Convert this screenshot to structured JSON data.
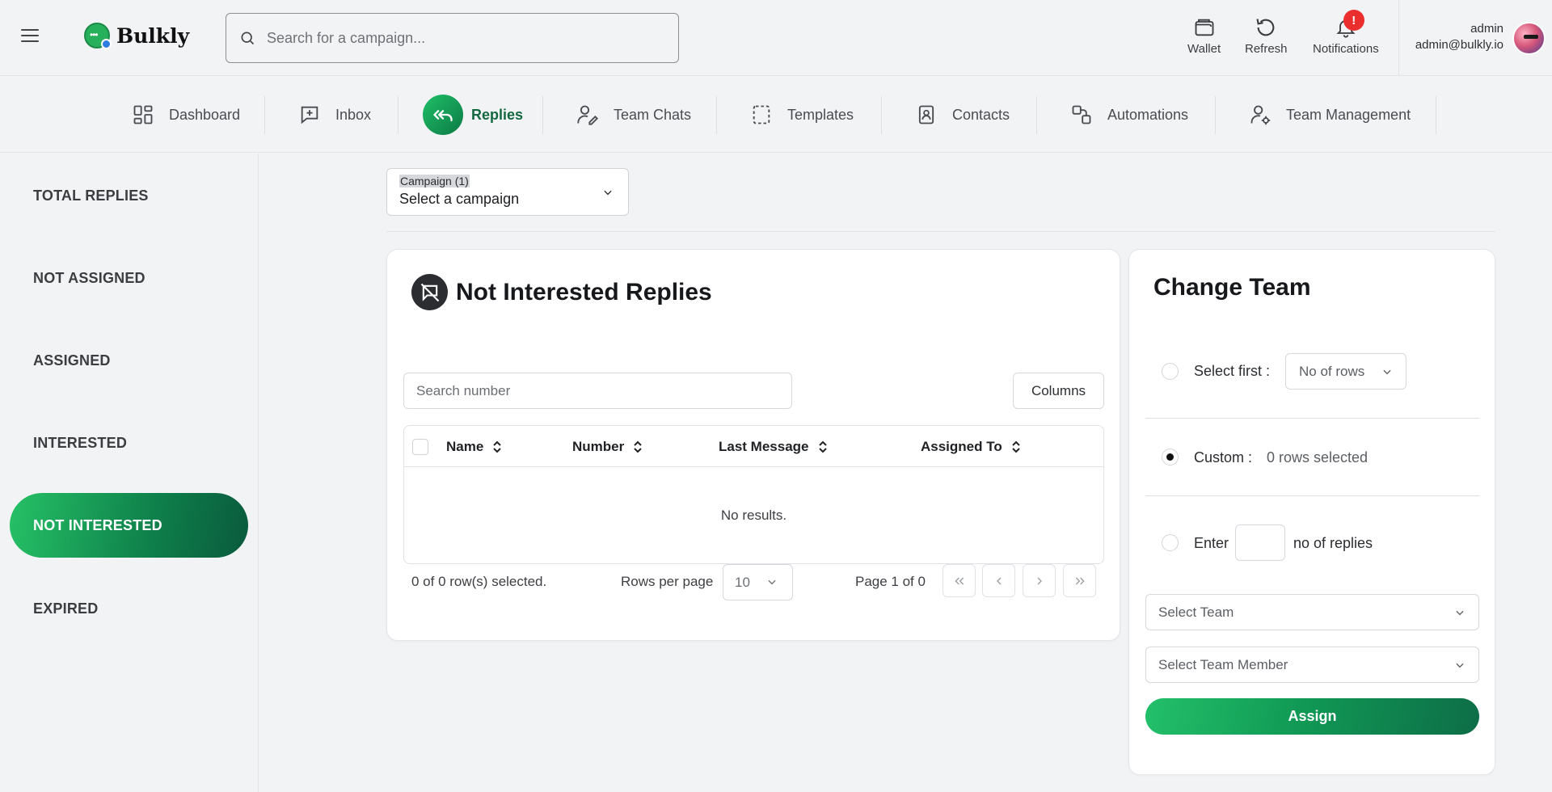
{
  "header": {
    "app_name": "Bulkly",
    "search_placeholder": "Search for a campaign...",
    "actions": [
      {
        "label": "Wallet",
        "icon": "wallet-icon"
      },
      {
        "label": "Refresh",
        "icon": "refresh-icon"
      },
      {
        "label": "Notifications",
        "icon": "bell-icon",
        "badge": "!"
      }
    ],
    "user": {
      "name": "admin",
      "email": "admin@bulkly.io"
    }
  },
  "nav": {
    "items": [
      {
        "label": "Dashboard",
        "icon": "dashboard-icon"
      },
      {
        "label": "Inbox",
        "icon": "inbox-icon"
      },
      {
        "label": "Replies",
        "icon": "reply-all-icon",
        "active": true
      },
      {
        "label": "Team Chats",
        "icon": "team-chats-icon"
      },
      {
        "label": "Templates",
        "icon": "templates-icon"
      },
      {
        "label": "Contacts",
        "icon": "contacts-icon"
      },
      {
        "label": "Automations",
        "icon": "automations-icon"
      },
      {
        "label": "Team Management",
        "icon": "team-management-icon"
      }
    ]
  },
  "sidebar": {
    "items": [
      {
        "label": "TOTAL REPLIES"
      },
      {
        "label": "NOT ASSIGNED"
      },
      {
        "label": "ASSIGNED"
      },
      {
        "label": "INTERESTED"
      },
      {
        "label": "NOT INTERESTED",
        "active": true
      },
      {
        "label": "EXPIRED"
      }
    ]
  },
  "campaign": {
    "label": "Campaign (1)",
    "value": "Select a campaign"
  },
  "replies": {
    "title": "Not Interested Replies",
    "search_placeholder": "Search number",
    "columns_label": "Columns",
    "table": {
      "headers": [
        "Name",
        "Number",
        "Last Message",
        "Assigned To"
      ],
      "empty": "No results."
    },
    "footer": {
      "selected": "0 of 0 row(s) selected.",
      "rows_per_page_label": "Rows per page",
      "rows_per_page": "10",
      "page": "Page 1 of 0"
    }
  },
  "change_team": {
    "title": "Change Team",
    "select_first_label": "Select first :",
    "no_of_rows_placeholder": "No of rows",
    "custom_label": "Custom :",
    "custom_value": "0 rows selected",
    "enter_label": "Enter",
    "enter_suffix": "no of replies",
    "select_team": "Select Team",
    "select_team_member": "Select Team Member",
    "assign_label": "Assign"
  },
  "colors": {
    "accent": "#1a9d58",
    "accent_dark": "#0d6d47",
    "notification": "#ea2e2e",
    "background": "#f2f3f5"
  }
}
